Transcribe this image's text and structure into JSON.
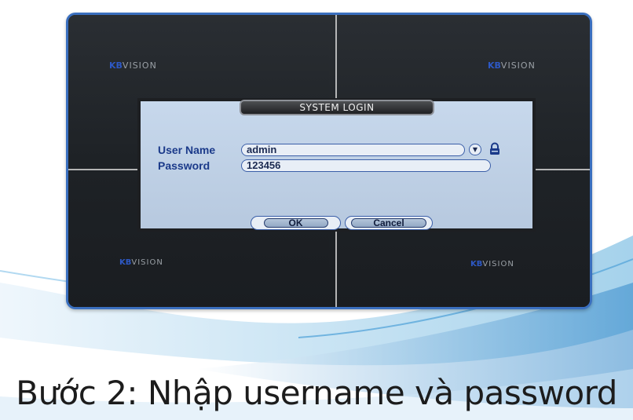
{
  "caption": "Bước 2: Nhập username và password",
  "dvr": {
    "brand_prefix": "KB",
    "brand_suffix": "VISION",
    "dialog": {
      "title": "SYSTEM LOGIN",
      "username_label": "User Name",
      "username_value": "admin",
      "password_label": "Password",
      "password_value": "123456",
      "ok_label": "OK",
      "cancel_label": "Cancel"
    }
  },
  "colors": {
    "arrow": "#ff33cc",
    "frame": "#3a6fbf",
    "label": "#1b3a8a"
  },
  "icons": [
    "lock-icon",
    "chevron-down-icon",
    "pointer-arrow-icon"
  ]
}
